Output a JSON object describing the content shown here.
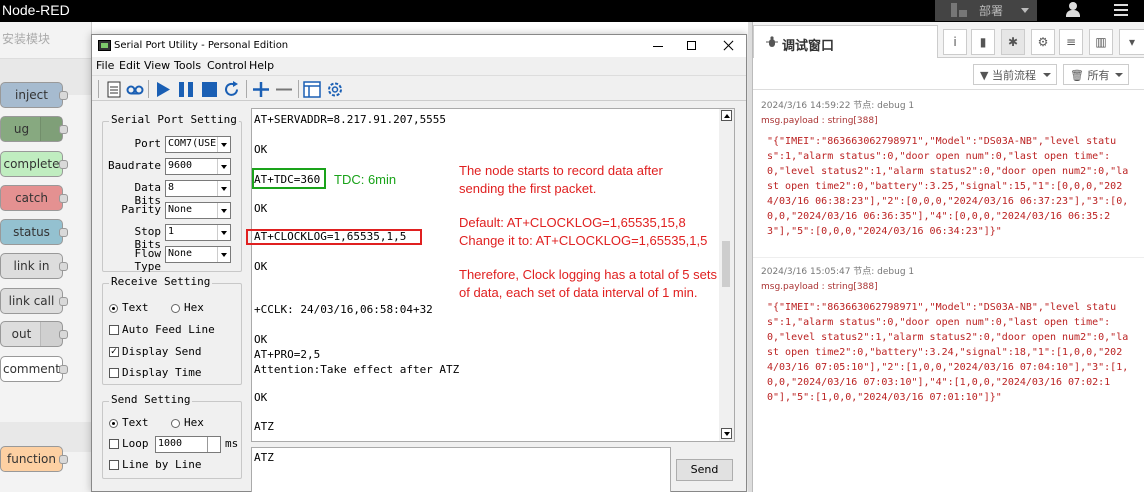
{
  "nodered": {
    "title": "Node-RED",
    "deploy_label": "部署",
    "palette_search_placeholder": "安装模块",
    "nodes": [
      {
        "label": "inject",
        "color": "#a6bbcf"
      },
      {
        "label": "ug",
        "color": "#87a980"
      },
      {
        "label": "complete",
        "color": "#c0edc0"
      },
      {
        "label": "catch",
        "color": "#e49191"
      },
      {
        "label": "status",
        "color": "#94c1d0"
      },
      {
        "label": "link in",
        "color": "#dddddd"
      },
      {
        "label": "link call",
        "color": "#dddddd"
      },
      {
        "label": "out",
        "color": "#dddddd"
      },
      {
        "label": "comment",
        "color": "#ffffff"
      },
      {
        "label": "function",
        "color": "#fdd0a2"
      }
    ]
  },
  "spu": {
    "title": "Serial Port Utility - Personal Edition",
    "menu": [
      "File",
      "Edit",
      "View",
      "Tools",
      "Control",
      "Help"
    ],
    "port_setting": {
      "title": "Serial Port Setting",
      "rows": [
        {
          "label": "Port",
          "value": "COM7(USE"
        },
        {
          "label": "Baudrate",
          "value": "9600"
        },
        {
          "label": "Data Bits",
          "value": "8"
        },
        {
          "label": "Parity",
          "value": "None"
        },
        {
          "label": "Stop Bits",
          "value": "1"
        },
        {
          "label": "Flow Type",
          "value": "None"
        }
      ]
    },
    "receive_setting": {
      "title": "Receive Setting",
      "text_label": "Text",
      "hex_label": "Hex",
      "auto_feed": "Auto Feed Line",
      "display_send": "Display Send",
      "display_time": "Display Time"
    },
    "send_setting": {
      "title": "Send Setting",
      "text_label": "Text",
      "hex_label": "Hex",
      "loop_label": "Loop",
      "loop_value": "1000",
      "ms_label": "ms",
      "line_by_line": "Line by Line"
    },
    "receive_lines": [
      "AT+SERVADDR=8.217.91.207,5555",
      "OK",
      "AT+TDC=360",
      "OK",
      "AT+CLOCKLOG=1,65535,1,5",
      "OK",
      "+CCLK: 24/03/16,06:58:04+32",
      "OK",
      "AT+PRO=2,5",
      "Attention:Take effect after ATZ",
      "OK",
      "ATZ"
    ],
    "annotations": {
      "tdc_note": "TDC: 6min",
      "note1_line1": "The node starts to record data after",
      "note1_line2": "sending the first packet.",
      "note2_line1": "Default: AT+CLOCKLOG=1,65535,15,8",
      "note2_line2": "Change it to: AT+CLOCKLOG=1,65535,1,5",
      "note3_line1": "Therefore, Clock logging has a total of 5 sets",
      "note3_line2": "of data, each set of data interval of 1 min."
    },
    "send_text": "ATZ",
    "send_button": "Send"
  },
  "debug": {
    "tab_title": "调试窗口",
    "filter_flow": "当前流程",
    "filter_all": "所有",
    "messages": [
      {
        "meta": "2024/3/16 14:59:22  节点: debug 1",
        "type": "msg.payload : string[388]",
        "payload": "\"{\"IMEI\":\"863663062798971\",\"Model\":\"DS03A-NB\",\"level status\":1,\"alarm status\":0,\"door open num\":0,\"last open time\":0,\"level status2\":1,\"alarm status2\":0,\"door open num2\":0,\"last open time2\":0,\"battery\":3.25,\"signal\":15,\"1\":[0,0,0,\"2024/03/16 06:38:23\"],\"2\":[0,0,0,\"2024/03/16 06:37:23\"],\"3\":[0,0,0,\"2024/03/16 06:36:35\"],\"4\":[0,0,0,\"2024/03/16 06:35:23\"],\"5\":[0,0,0,\"2024/03/16 06:34:23\"]}\""
      },
      {
        "meta": "2024/3/16 15:05:47  节点: debug 1",
        "type": "msg.payload : string[388]",
        "payload": "\"{\"IMEI\":\"863663062798971\",\"Model\":\"DS03A-NB\",\"level status\":1,\"alarm status\":0,\"door open num\":0,\"last open time\":0,\"level status2\":1,\"alarm status2\":0,\"door open num2\":0,\"last open time2\":0,\"battery\":3.24,\"signal\":18,\"1\":[1,0,0,\"2024/03/16 07:05:10\"],\"2\":[1,0,0,\"2024/03/16 07:04:10\"],\"3\":[1,0,0,\"2024/03/16 07:03:10\"],\"4\":[1,0,0,\"2024/03/16 07:02:10\"],\"5\":[1,0,0,\"2024/03/16 07:01:10\"]}\""
      }
    ]
  }
}
